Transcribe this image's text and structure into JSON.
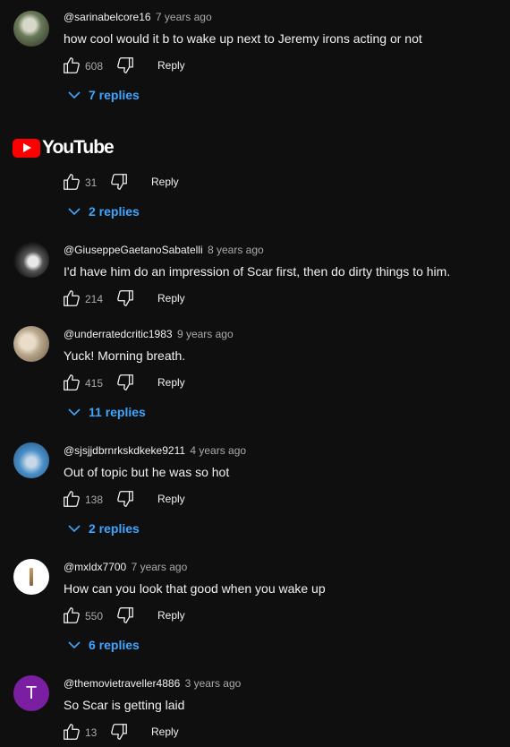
{
  "comments": [
    {
      "handle": "@sarinabelcore16",
      "time": "7 years ago",
      "text": "how cool would it b to wake up next to Jeremy irons acting or not",
      "likes": "608",
      "reply": "Reply",
      "replies": "7 replies",
      "avatar_color": "#6a7a5a"
    },
    {
      "likes": "31",
      "reply": "Reply",
      "replies": "2 replies"
    },
    {
      "handle": "@GiuseppeGaetanoSabatelli",
      "time": "8 years ago",
      "text": "I'd have him do an impression of Scar first, then do dirty things to him.",
      "likes": "214",
      "reply": "Reply",
      "avatar_color": "#cccccc"
    },
    {
      "handle": "@underratedcritic1983",
      "time": "9 years ago",
      "text": "Yuck! Morning breath.",
      "likes": "415",
      "reply": "Reply",
      "replies": "11 replies",
      "avatar_color": "#b7a58c"
    },
    {
      "handle": "@sjsjjdbrnrkskdkeke9211",
      "time": "4 years ago",
      "text": "Out of topic but he was so hot",
      "likes": "138",
      "reply": "Reply",
      "replies": "2 replies",
      "avatar_color": "#4a8fc7"
    },
    {
      "handle": "@mxldx7700",
      "time": "7 years ago",
      "text": "How can you look that good when you wake up",
      "likes": "550",
      "reply": "Reply",
      "replies": "6 replies",
      "avatar_color": "#ffffff"
    },
    {
      "handle": "@themovietraveller4886",
      "time": "3 years ago",
      "text": "So Scar is getting laid",
      "likes": "13",
      "reply": "Reply",
      "avatar_letter": "T",
      "avatar_color": "#7b1fa2"
    }
  ],
  "logo": {
    "text": "YouTube"
  },
  "colors": {
    "background": "#0f0f0f",
    "link": "#3ea6ff",
    "meta": "#aaaaaa",
    "logo_red": "#ff0000"
  }
}
